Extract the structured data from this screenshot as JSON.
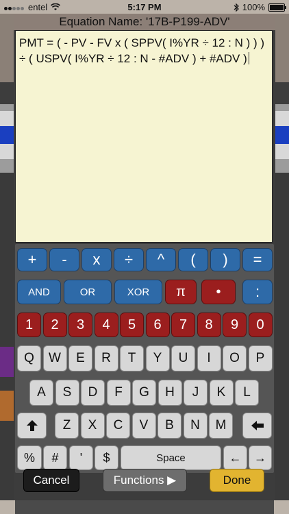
{
  "status_bar": {
    "carrier": "entel",
    "time": "5:17 PM",
    "battery_percent": "100%",
    "signal_bars": 2,
    "icons": [
      "signal-icon",
      "wifi-icon",
      "bluetooth-icon",
      "battery-icon"
    ]
  },
  "dialog": {
    "title": "Equation Name: '17B-P199-ADV'",
    "equation_text": "PMT = ( - PV - FV x ( SPPV( I%YR ÷ 12 : N ) ) ) ÷ ( USPV( I%YR ÷ 12 : N - #ADV ) + #ADV )"
  },
  "keyboard": {
    "operator_row": [
      "+",
      "-",
      "x",
      "÷",
      "^",
      "(",
      ")",
      "="
    ],
    "logic_row": [
      "AND",
      "OR",
      "XOR",
      "π",
      "•",
      ":"
    ],
    "digit_row": [
      "1",
      "2",
      "3",
      "4",
      "5",
      "6",
      "7",
      "8",
      "9",
      "0"
    ],
    "row_q": [
      "Q",
      "W",
      "E",
      "R",
      "T",
      "Y",
      "U",
      "I",
      "O",
      "P"
    ],
    "row_a": [
      "A",
      "S",
      "D",
      "F",
      "G",
      "H",
      "J",
      "K",
      "L"
    ],
    "row_z": [
      "Z",
      "X",
      "C",
      "V",
      "B",
      "N",
      "M"
    ],
    "shift_icon": "shift-up-arrow-icon",
    "backspace_icon": "backspace-arrow-icon",
    "bottom_row": {
      "percent": "%",
      "hash": "#",
      "apostrophe": "'",
      "dollar": "$",
      "space": "Space",
      "left_arrow": "←",
      "right_arrow": "→"
    }
  },
  "buttons": {
    "cancel": "Cancel",
    "functions": "Functions ▶",
    "done": "Done"
  },
  "colors": {
    "operator_key": "#2e6aa8",
    "red_key": "#9b1e1e",
    "done_button": "#e2b430",
    "equation_background": "#f6f4d2",
    "title_bar": "#8c7f77"
  }
}
